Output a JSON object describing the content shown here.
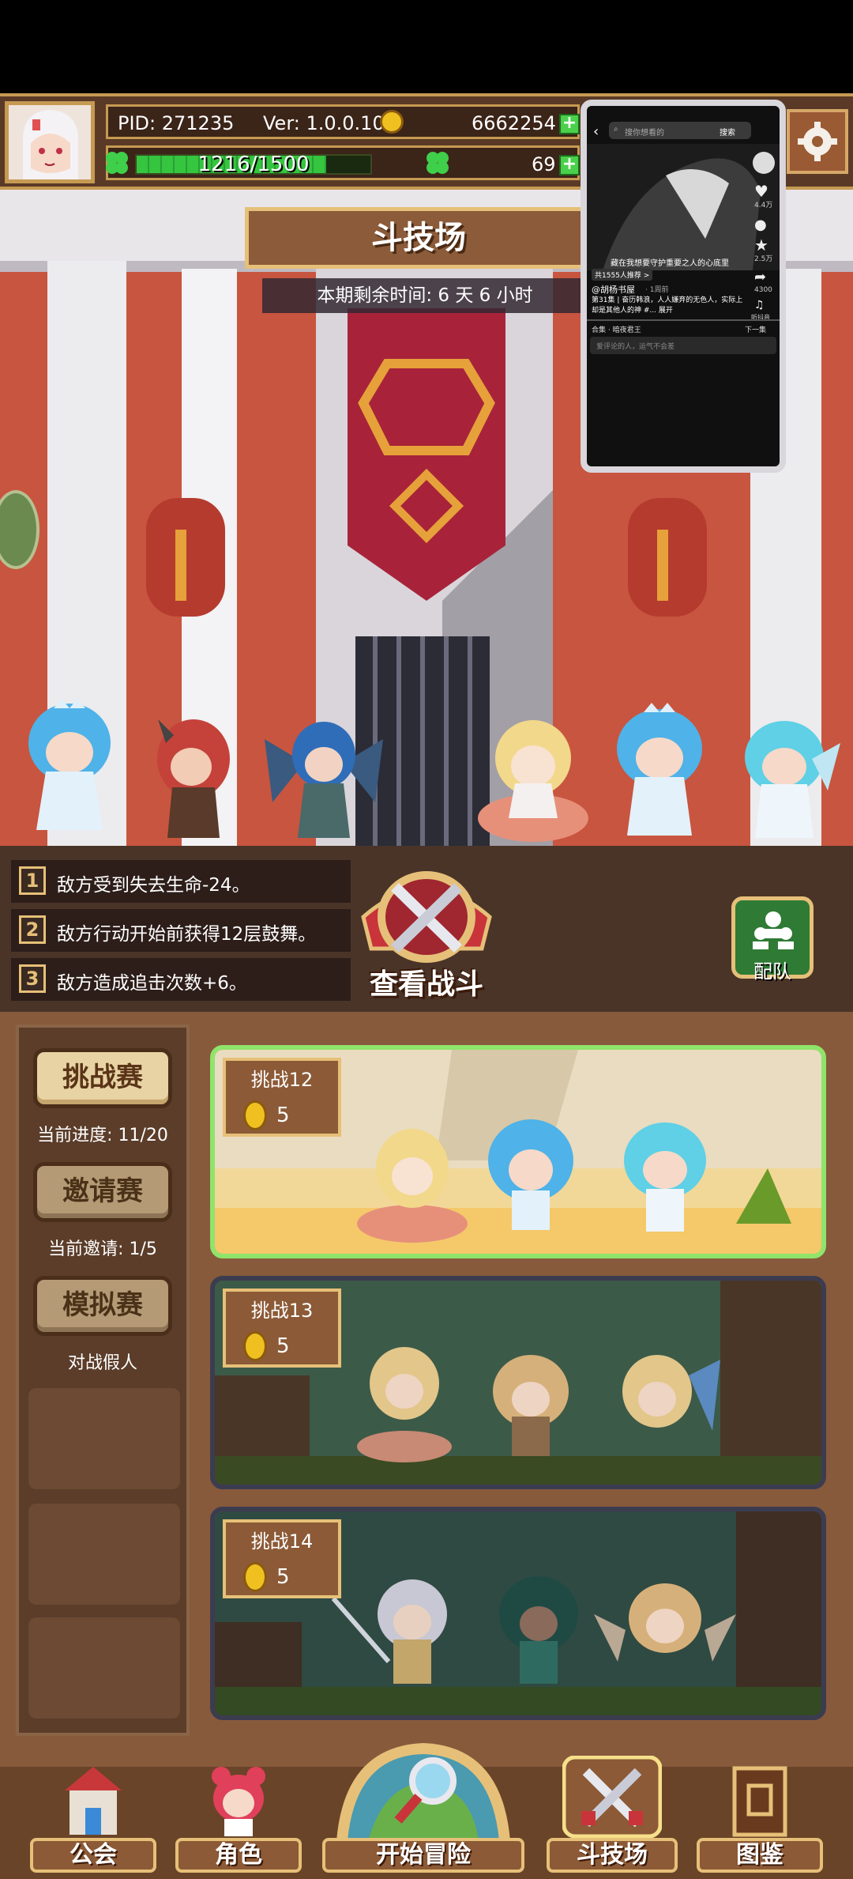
{
  "header": {
    "pid": "PID: 271235",
    "version": "Ver: 1.0.0.10",
    "gold": "6662254",
    "energy_text": "1216/1500",
    "energy_fraction": 0.81,
    "clover_count": "69"
  },
  "arena": {
    "title": "斗技场",
    "timer": "本期剩余时间: 6 天 6 小时"
  },
  "overlay_video": {
    "search_placeholder": "搜你想看的",
    "search_button": "搜索",
    "caption": "藏在我想要守护重要之人的心底里",
    "recommend": "共1555人推荐 >",
    "author": "@胡杨书屋",
    "time_ago": "· 1周前",
    "description": "第31集 | 奋历韩浪，人人嫌弃的无色人，实际上却是其他人的神 #... 展开",
    "collection": "合集 · 暗夜君王",
    "next": "下一集",
    "comment_placeholder": "爱评论的人，运气不会差",
    "likes": "4.4万",
    "comments": "—",
    "stars": "2.5万",
    "shares": "4300",
    "listen": "听抖音"
  },
  "effects": [
    {
      "num": "1",
      "text": "敌方受到失去生命-24。"
    },
    {
      "num": "2",
      "text": "敌方行动开始前获得12层鼓舞。"
    },
    {
      "num": "3",
      "text": "敌方造成追击次数+6。"
    }
  ],
  "battle": {
    "label": "查看战斗"
  },
  "team": {
    "label": "配队"
  },
  "modes": [
    {
      "label": "挑战赛",
      "sub": "当前进度: 11/20"
    },
    {
      "label": "邀请赛",
      "sub": "当前邀请: 1/5"
    },
    {
      "label": "模拟赛",
      "sub": "对战假人"
    }
  ],
  "challenges": [
    {
      "title": "挑战12",
      "cost": "5"
    },
    {
      "title": "挑战13",
      "cost": "5"
    },
    {
      "title": "挑战14",
      "cost": "5"
    }
  ],
  "nav": [
    {
      "label": "公会",
      "icon": "guild-building-icon"
    },
    {
      "label": "角色",
      "icon": "character-icon"
    },
    {
      "label": "开始冒险",
      "icon": "magnifier-map-icon"
    },
    {
      "label": "斗技场",
      "icon": "crossed-swords-icon"
    },
    {
      "label": "图鉴",
      "icon": "book-icon"
    }
  ],
  "colors": {
    "panel_brown": "#8c5a36",
    "gold_trim": "#e6c078",
    "energy_green": "#35c53f",
    "active_border": "#8fe46a"
  }
}
